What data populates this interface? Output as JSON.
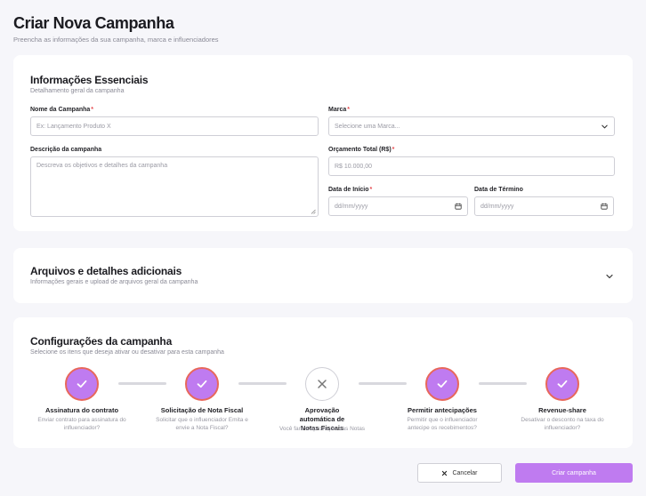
{
  "header": {
    "title": "Criar Nova Campanha",
    "subtitle": "Preencha as informações da sua campanha, marca e influenciadores"
  },
  "essentials": {
    "title": "Informações Essenciais",
    "subtitle": "Detalhamento geral da campanha",
    "campaign_name": {
      "label": "Nome da Campanha",
      "required": "*",
      "placeholder": "Ex: Lançamento Produto X"
    },
    "brand": {
      "label": "Marca",
      "required": "*",
      "placeholder": "Selecione uma Marca..."
    },
    "description": {
      "label": "Descrição da campanha",
      "placeholder": "Descreva os objetivos e detalhes da campanha"
    },
    "budget": {
      "label": "Orçamento Total (R$)",
      "required": "*",
      "placeholder": "R$ 10.000,00"
    },
    "start_date": {
      "label": "Data de Início",
      "required": "*",
      "placeholder": "dd/mm/yyyy"
    },
    "end_date": {
      "label": "Data de Término",
      "placeholder": "dd/mm/yyyy"
    }
  },
  "files": {
    "title": "Arquivos e detalhes adicionais",
    "subtitle": "Informações gerais e upload de arquivos geral da campanha"
  },
  "config": {
    "title": "Configurações da campanha",
    "subtitle": "Selecione os itens que deseja ativar ou desativar para esta campanha",
    "steps": [
      {
        "title": "Assinatura do contrato",
        "desc": "Enviar contrato para assinatura do influenciador?",
        "enabled": true
      },
      {
        "title": "Solicitação de Nota Fiscal",
        "desc": "Solicitar que o influenciador Emita e envie a Nota Fiscal?",
        "enabled": true
      },
      {
        "title": "Aprovação automática de Notas Fiscais",
        "desc": "Você fara a aprovação das Notas",
        "enabled": false
      },
      {
        "title": "Permitir antecipações",
        "desc": "Permitir que o influenciador antecipe os recebimentos?",
        "enabled": true
      },
      {
        "title": "Revenue-share",
        "desc": "Desativar o desconto na taxa do influenciador?",
        "enabled": true
      }
    ]
  },
  "actions": {
    "cancel_label": "Cancelar",
    "create_label": "Criar campanha"
  },
  "colors": {
    "accent": "#bf7bf0",
    "accent_border": "#e8685b",
    "required": "#e5484d"
  },
  "icons": {
    "brand_trailing": "chevron-down-icon",
    "date_trailing": "calendar-icon",
    "files_toggle": "chevron-down-icon",
    "step_on": "check-icon",
    "step_off": "x-icon",
    "cancel": "x-icon"
  }
}
